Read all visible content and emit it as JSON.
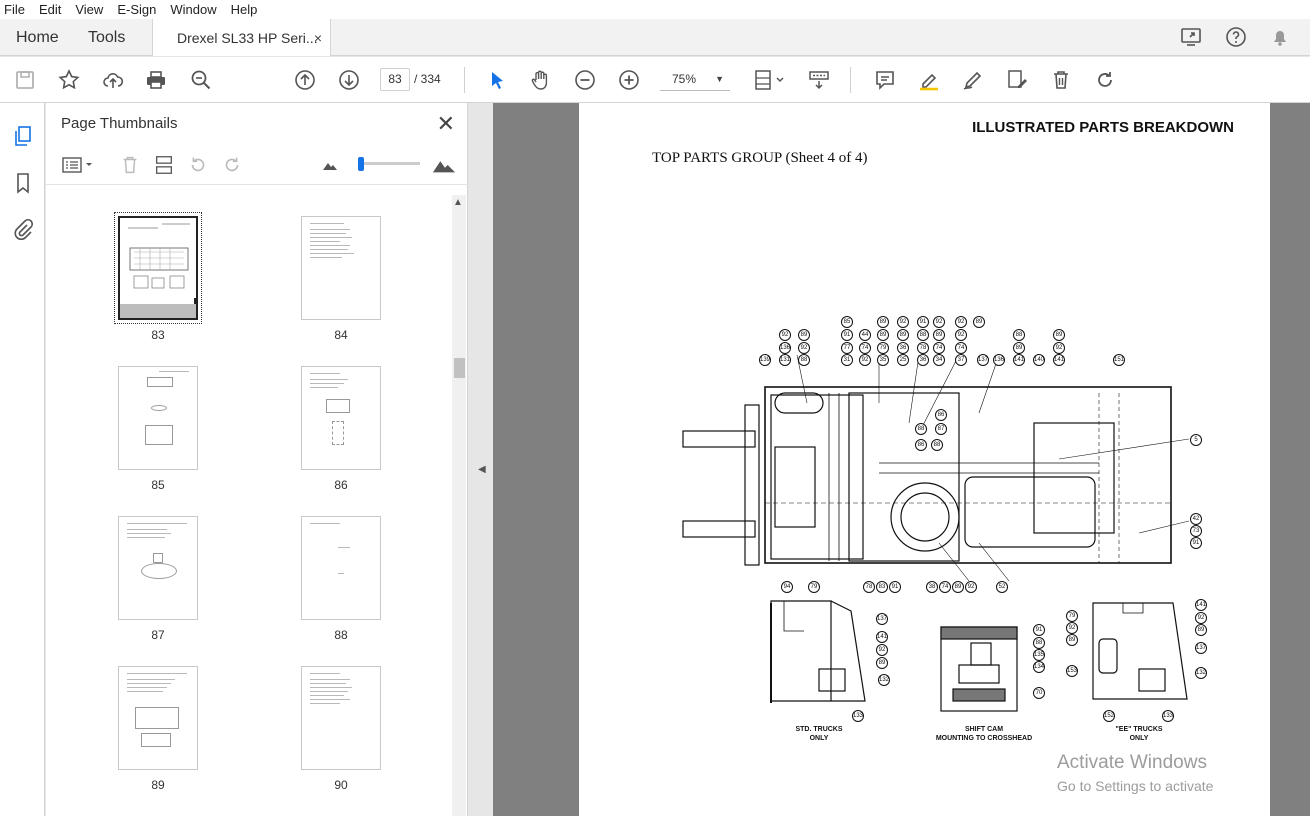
{
  "menu": [
    "File",
    "Edit",
    "View",
    "E-Sign",
    "Window",
    "Help"
  ],
  "tabs": {
    "home": "Home",
    "tools": "Tools",
    "document": "Drexel SL33 HP Seri...",
    "close": "×"
  },
  "toolbar": {
    "current_page": "83",
    "page_total": "/  334",
    "zoom": "75%"
  },
  "thumbnails": {
    "title": "Page Thumbnails",
    "close": "✕",
    "pages": [
      "83",
      "84",
      "85",
      "86",
      "87",
      "88",
      "89",
      "90"
    ]
  },
  "document": {
    "header": "ILLUSTRATED PARTS BREAKDOWN",
    "subtitle": "TOP PARTS GROUP (Sheet 4 of 4)",
    "captions": {
      "std_l1": "STD. TRUCKS",
      "std_l2": "ONLY",
      "shift_l1": "SHIFT CAM",
      "shift_l2": "MOUNTING TO CROSSHEAD",
      "ee_l1": "\"EE\" TRUCKS",
      "ee_l2": "ONLY"
    },
    "callouts_top_rows": [
      [
        "85",
        "89",
        "92",
        "91",
        "92",
        "92",
        "89"
      ],
      [
        "92",
        "89",
        "91",
        "44",
        "89",
        "89",
        "88",
        "89",
        "92",
        "88",
        "89"
      ],
      [
        "136",
        "92",
        "77",
        "74",
        "79",
        "36",
        "78",
        "74",
        "74",
        "89",
        "92"
      ],
      [
        "139",
        "131",
        "88",
        "31",
        "92",
        "35",
        "25",
        "36",
        "34",
        "37",
        "137",
        "136",
        "141",
        "140",
        "141",
        "151"
      ]
    ],
    "callouts_side": [
      "5",
      "42",
      "73",
      "91",
      "86",
      "87",
      "88",
      "86",
      "88"
    ],
    "callouts_bottom": [
      "94",
      "79",
      "78",
      "83",
      "91",
      "38",
      "74",
      "89",
      "92",
      "52"
    ],
    "callouts_left_detail": [
      "137",
      "141",
      "92",
      "89",
      "132",
      "133"
    ],
    "callouts_mid_detail": [
      "91",
      "88",
      "135",
      "134",
      "70"
    ],
    "callouts_right_detail": [
      "79",
      "92",
      "89",
      "141",
      "92",
      "89",
      "137",
      "132",
      "153",
      "152",
      "133"
    ]
  },
  "watermark": {
    "line1": "Activate Windows",
    "line2": "Go to Settings to activate"
  }
}
